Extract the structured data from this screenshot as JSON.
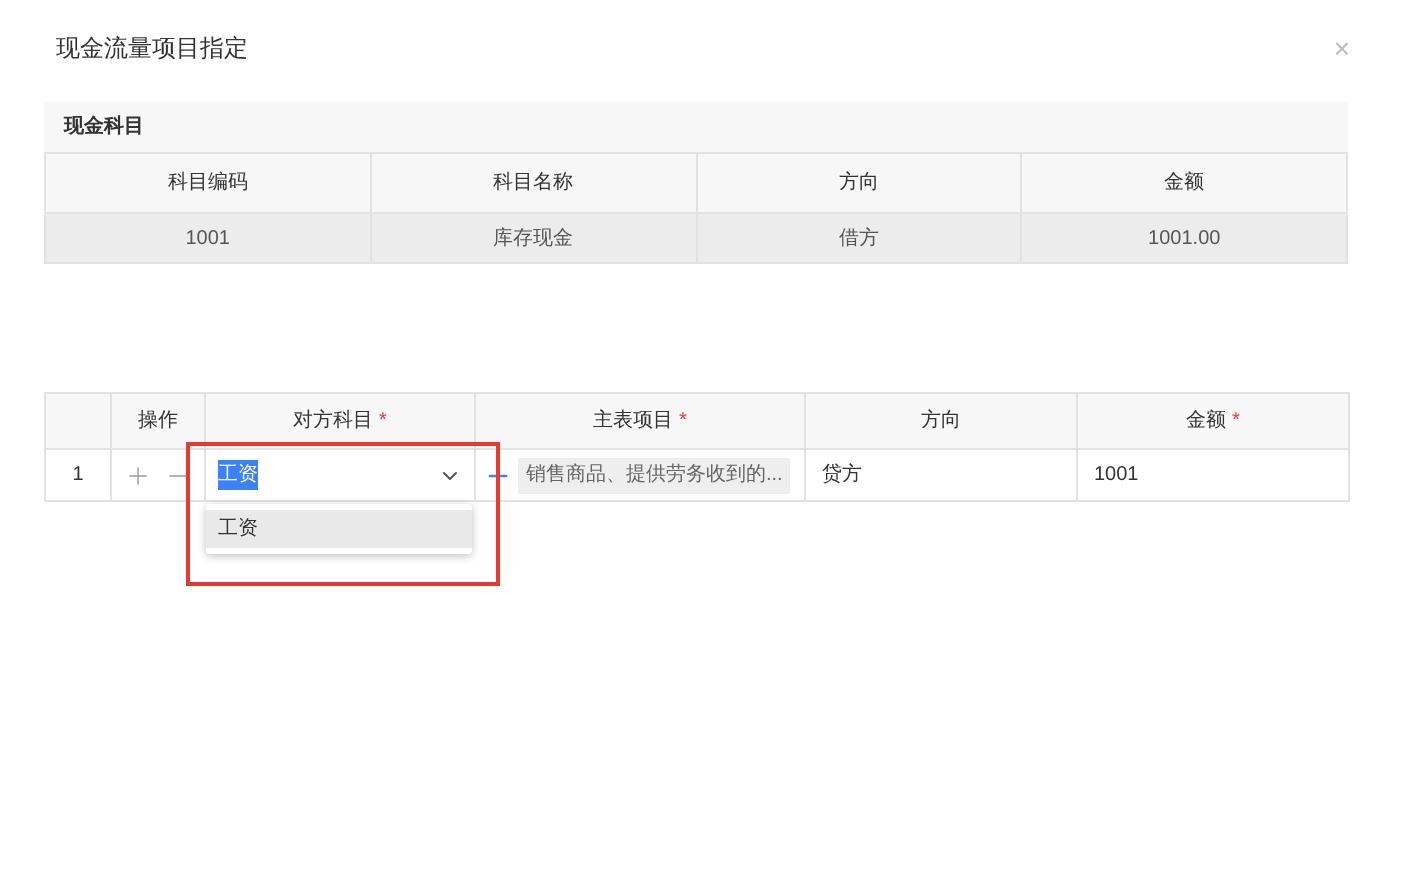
{
  "dialog": {
    "title": "现金流量项目指定",
    "close": "×"
  },
  "cash_account": {
    "title": "现金科目",
    "columns": [
      "科目编码",
      "科目名称",
      "方向",
      "金额"
    ],
    "rows": [
      [
        "1001",
        "库存现金",
        "借方",
        "1001.00"
      ]
    ]
  },
  "entries": {
    "columns": [
      {
        "label": "操作"
      },
      {
        "label": "对方科目",
        "required_mark": "*"
      },
      {
        "label": "主表项目",
        "required_mark": "*"
      },
      {
        "label": "方向"
      },
      {
        "label": "金额",
        "required_mark": "*"
      }
    ],
    "rows": [
      {
        "index": "1",
        "counter_account": {
          "value": "工资",
          "text_selected": true
        },
        "main_item": "销售商品、提供劳务收到的...",
        "direction": "贷方",
        "amount": "1001"
      }
    ]
  },
  "dropdown": {
    "options": [
      {
        "label": "工资",
        "selected": true
      }
    ]
  }
}
